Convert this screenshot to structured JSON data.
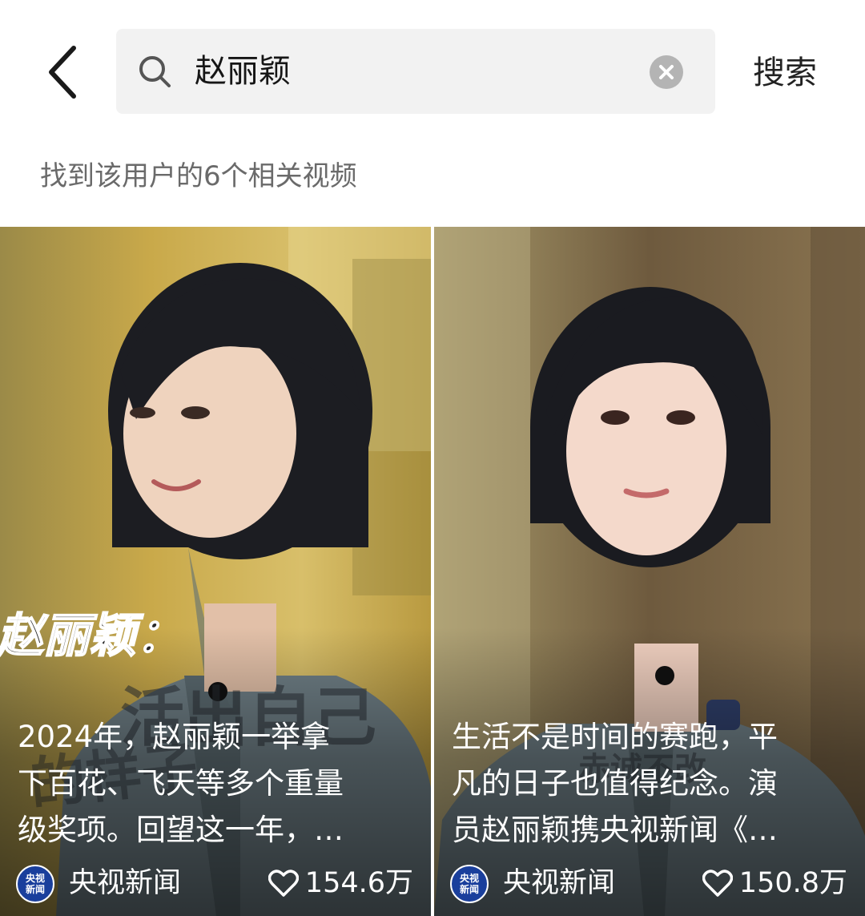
{
  "search": {
    "query": "赵丽颖",
    "button_label": "搜索"
  },
  "results": {
    "summary": "找到该用户的6个相关视频"
  },
  "videos": [
    {
      "caption_lines": [
        "2024年，赵丽颖一举拿",
        "下百花、飞天等多个重量",
        "级奖项。回望这一年，…"
      ],
      "overlay_text": "赵丽颖：",
      "author": "央视新闻",
      "likes": "154.6万"
    },
    {
      "caption_lines": [
        "生活不是时间的赛跑，平",
        "凡的日子也值得纪念。演",
        "员赵丽颖携央视新闻《…"
      ],
      "author": "央视新闻",
      "likes": "150.8万"
    }
  ],
  "avatar_text": [
    "央视",
    "新闻"
  ],
  "icons": [
    "back-arrow-icon",
    "search-icon",
    "clear-icon",
    "heart-icon"
  ],
  "colors": {
    "search_bg": "#f2f2f2",
    "secondary_text": "#6a6a6a",
    "clear_icon": "#b4b4b4",
    "avatar_bg": "#1a3f9c"
  }
}
